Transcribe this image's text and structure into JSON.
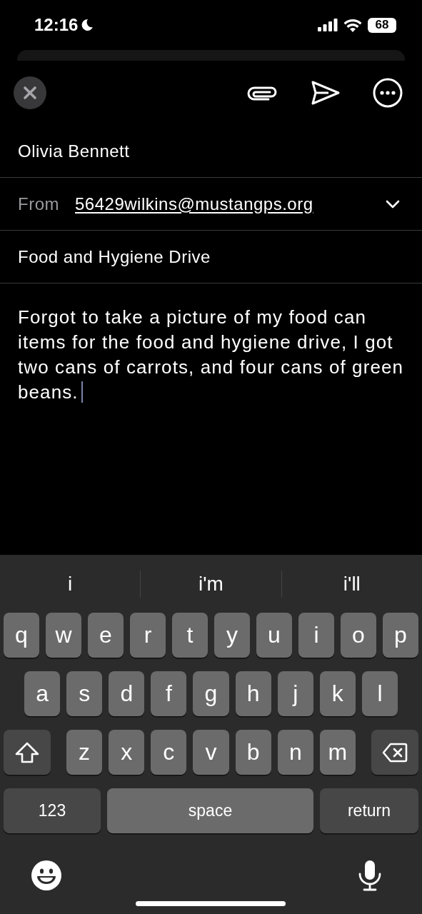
{
  "status_bar": {
    "time": "12:16",
    "battery": "68"
  },
  "compose": {
    "to": "Olivia Bennett",
    "from": {
      "label": "From",
      "address": "56429wilkins@mustangps.org"
    },
    "subject": "Food and Hygiene Drive",
    "body": "Forgot to take a picture of my food can items for the food and hygiene drive, I got two cans of carrots, and four cans of green beans."
  },
  "keyboard": {
    "suggestions": [
      "i",
      "i'm",
      "i'll"
    ],
    "letter_rows": [
      [
        {
          "kind": "letter",
          "label": "q"
        },
        {
          "kind": "letter",
          "label": "w"
        },
        {
          "kind": "letter",
          "label": "e"
        },
        {
          "kind": "letter",
          "label": "r"
        },
        {
          "kind": "letter",
          "label": "t"
        },
        {
          "kind": "letter",
          "label": "y"
        },
        {
          "kind": "letter",
          "label": "u"
        },
        {
          "kind": "letter",
          "label": "i"
        },
        {
          "kind": "letter",
          "label": "o"
        },
        {
          "kind": "letter",
          "label": "p"
        }
      ],
      [
        {
          "kind": "letter",
          "label": "a"
        },
        {
          "kind": "letter",
          "label": "s"
        },
        {
          "kind": "letter",
          "label": "d"
        },
        {
          "kind": "letter",
          "label": "f"
        },
        {
          "kind": "letter",
          "label": "g"
        },
        {
          "kind": "letter",
          "label": "h"
        },
        {
          "kind": "letter",
          "label": "j"
        },
        {
          "kind": "letter",
          "label": "k"
        },
        {
          "kind": "letter",
          "label": "l"
        }
      ],
      [
        {
          "kind": "shift"
        },
        {
          "kind": "letter",
          "label": "z"
        },
        {
          "kind": "letter",
          "label": "x"
        },
        {
          "kind": "letter",
          "label": "c"
        },
        {
          "kind": "letter",
          "label": "v"
        },
        {
          "kind": "letter",
          "label": "b"
        },
        {
          "kind": "letter",
          "label": "n"
        },
        {
          "kind": "letter",
          "label": "m"
        },
        {
          "kind": "delete"
        }
      ]
    ],
    "bottom_keys": [
      {
        "kind": "numbers",
        "label": "123"
      },
      {
        "kind": "space",
        "label": "space"
      },
      {
        "kind": "return",
        "label": "return"
      }
    ]
  }
}
